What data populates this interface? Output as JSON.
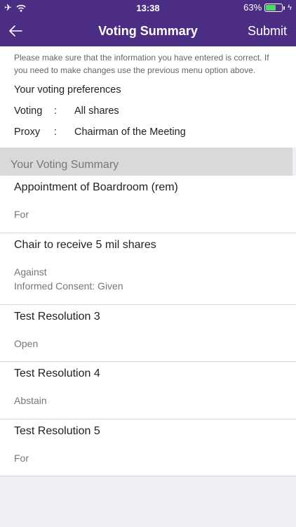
{
  "status": {
    "time": "13:38",
    "battery": "63%",
    "battery_level": 0.63
  },
  "nav": {
    "title": "Voting Summary",
    "submit": "Submit"
  },
  "info": {
    "notice": "Please make sure that the information you have entered is correct. If you need to make changes use the previous menu option above.",
    "prefs_title": "Your voting preferences",
    "prefs": [
      {
        "key": "Voting",
        "sep": ":",
        "value": "All shares"
      },
      {
        "key": "Proxy",
        "sep": ":",
        "value": "Chairman of the Meeting"
      }
    ]
  },
  "summary": {
    "header": "Your Voting Summary",
    "items": [
      {
        "title": "Appointment of Boardroom (rem)",
        "lines": [
          "For"
        ]
      },
      {
        "title": "Chair to receive 5 mil shares",
        "lines": [
          "Against",
          "Informed Consent: Given"
        ]
      },
      {
        "title": "Test Resolution 3",
        "lines": [
          "Open"
        ]
      },
      {
        "title": "Test Resolution 4",
        "lines": [
          "Abstain"
        ]
      },
      {
        "title": "Test Resolution 5",
        "lines": [
          "For"
        ]
      }
    ]
  }
}
